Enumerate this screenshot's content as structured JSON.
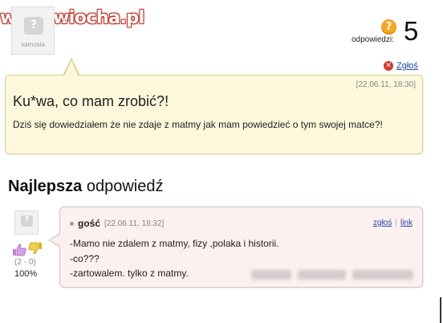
{
  "watermark": {
    "prefix": "www.",
    "domain": "wiocha.pl"
  },
  "asker": {
    "avatar_caption": "samosia",
    "name": "..."
  },
  "answers": {
    "label": "odpowiedzi:",
    "count": "5",
    "icon": "question-icon",
    "icon_color": "#f5a623"
  },
  "report": {
    "label": "Zgłoś",
    "icon": "close-circle-icon",
    "icon_color": "#d23b2f"
  },
  "question": {
    "date": "[22.06.11, 18:30]",
    "title": "Ku*wa, co mam zrobić?!",
    "body": "Dziś się dowiedziałem że nie zdaje z matmy jak mam powiedzieć o tym swojej matce?!"
  },
  "best_answer": {
    "heading_bold": "Najlepsza",
    "heading_rest": " odpowiedź",
    "author": "gość",
    "date": "[22.06.11, 18:32]",
    "report_link": "zgłoś",
    "separator": "|",
    "link_label": "link",
    "lines": [
      "-Mamo nie zdalem z matmy, fizy ,polaka i historii.",
      "-co???",
      "-zartowalem. tylko z matmy."
    ],
    "votes": {
      "score": "(2 - 0)",
      "percent": "100%"
    }
  },
  "colors": {
    "question_bg": "#fdf8dc",
    "answer_bg": "#fdf0f0",
    "link": "#1f4aa8",
    "watermark_outline": "#c0392b"
  }
}
